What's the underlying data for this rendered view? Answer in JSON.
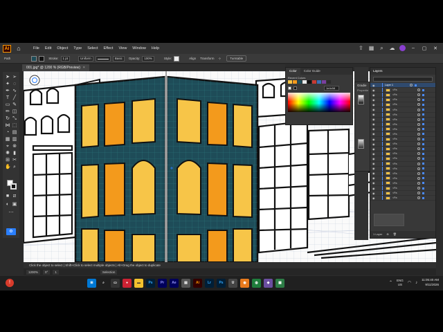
{
  "menubar": {
    "logo_text": "Ai",
    "items": [
      "File",
      "Edit",
      "Object",
      "Type",
      "Select",
      "Effect",
      "View",
      "Window",
      "Help"
    ]
  },
  "controlbar": {
    "selection_label": "Path",
    "stroke_label": "Stroke:",
    "stroke_value": "1 pt",
    "profile_value": "Uniform",
    "brush_value": "Basic",
    "opacity_label": "Opacity:",
    "opacity_value": "100%",
    "style_label": "Style:",
    "align_label": "Align",
    "transform_label": "Transform",
    "turntable_label": "Turntable"
  },
  "document_tab": {
    "title": "001.jpg* @ 1200 % (RGB/Preview)",
    "close": "×"
  },
  "color_panel": {
    "tabs": [
      "Color",
      "Color Guide"
    ],
    "recent_label": "Recent Colors",
    "recent_colors": [
      "#f6c345",
      "#f39a1c",
      "#1f4f5c",
      "#e8e8e8",
      "#111111",
      "#c63a32",
      "#3b6fb6",
      "#7a3fa0",
      "#2b2b2b"
    ],
    "hex_value": "1e4c58"
  },
  "gradient_panel": {
    "title": "Gradie",
    "properties_label": "Propertie"
  },
  "layers_panel": {
    "title": "Layers",
    "top_layer": "Layer 1",
    "sublayer_label": "<Pa",
    "row_count": 24,
    "footer_label": "1 Layer"
  },
  "hint_bar": {
    "text": "Click the object to select | Shift+Click to select multiple objects | Alt+Drag the object to duplicate"
  },
  "statusbar": {
    "zoom": "1200%",
    "rotation": "0°",
    "artboard": "1",
    "mode": "Selection"
  },
  "taskbar": {
    "language": "ENG",
    "region": "US",
    "time": "11:05:40 AM",
    "date": "9/11/2026",
    "apps": [
      {
        "label": "Ps",
        "color": "#001e36",
        "fg": "#31a8ff"
      },
      {
        "label": "Pr",
        "color": "#00005b",
        "fg": "#9999ff"
      },
      {
        "label": "Ae",
        "color": "#00005b",
        "fg": "#9999ff"
      },
      {
        "label": "Ai",
        "color": "#330000",
        "fg": "#ff9a00"
      },
      {
        "label": "Lr",
        "color": "#001e36",
        "fg": "#31a8ff"
      },
      {
        "label": "Ps",
        "color": "#001e36",
        "fg": "#31a8ff"
      }
    ]
  },
  "colors": {
    "teal": "#1e4c58",
    "yellow_window": "#f7c548",
    "orange_window": "#f39a1c",
    "accent_blue": "#2a7fff"
  }
}
